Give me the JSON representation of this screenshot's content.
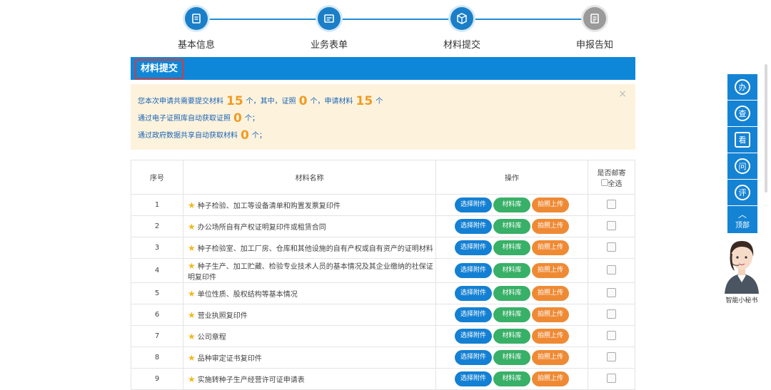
{
  "steps": [
    {
      "label": "基本信息",
      "icon": "document-icon"
    },
    {
      "label": "业务表单",
      "icon": "form-icon"
    },
    {
      "label": "材料提交",
      "icon": "box-icon"
    },
    {
      "label": "申报告知",
      "icon": "notice-icon"
    }
  ],
  "section_title": "材料提交",
  "notice": {
    "line1_prefix": "您本次申请共需要提交材料",
    "total": "15",
    "line1_mid1": "个，其中，证照",
    "cert_count": "0",
    "line1_mid2": "个，申请材料",
    "apply_count": "15",
    "line1_suffix": "个",
    "line2_prefix": "通过电子证照库自动获取证照",
    "auto_cert": "0",
    "line2_suffix": "个；",
    "line3_prefix": "通过政府数据共享自动获取材料",
    "auto_material": "0",
    "line3_suffix": "个；",
    "close": "×"
  },
  "table": {
    "headers": {
      "index": "序号",
      "name": "材料名称",
      "ops": "操作",
      "mail": "是否邮寄",
      "select_all": "全选"
    },
    "buttons": {
      "attach": "选择附件",
      "library": "材料库",
      "photo": "拍照上传"
    },
    "rows": [
      {
        "index": "1",
        "name": "种子检验、加工等设备清单和购置发票复印件"
      },
      {
        "index": "2",
        "name": "办公场所自有产权证明复印件或租赁合同"
      },
      {
        "index": "3",
        "name": "种子检验室、加工厂房、仓库和其他设施的自有产权或自有资产的证明材料"
      },
      {
        "index": "4",
        "name": "种子生产、加工贮藏、检验专业技术人员的基本情况及其企业缴纳的社保证明复印件"
      },
      {
        "index": "5",
        "name": "单位性质、股权结构等基本情况"
      },
      {
        "index": "6",
        "name": "营业执照复印件"
      },
      {
        "index": "7",
        "name": "公司章程"
      },
      {
        "index": "8",
        "name": "品种审定证书复印件"
      },
      {
        "index": "9",
        "name": "实施转种子生产经营许可证申请表"
      }
    ]
  },
  "sidebar": {
    "items": [
      {
        "glyph": "办",
        "icon": "handle-icon"
      },
      {
        "glyph": "查",
        "icon": "search-icon"
      },
      {
        "glyph": "看",
        "icon": "view-icon"
      },
      {
        "glyph": "问",
        "icon": "ask-icon"
      },
      {
        "glyph": "评",
        "icon": "rate-icon"
      }
    ],
    "top_label": "顶部",
    "assistant_label": "智能小秘书"
  },
  "colors": {
    "primary": "#0f87d8",
    "green": "#38b067",
    "orange": "#ef8a34",
    "notice_bg": "#fdf3dd",
    "number": "#f09a23"
  }
}
